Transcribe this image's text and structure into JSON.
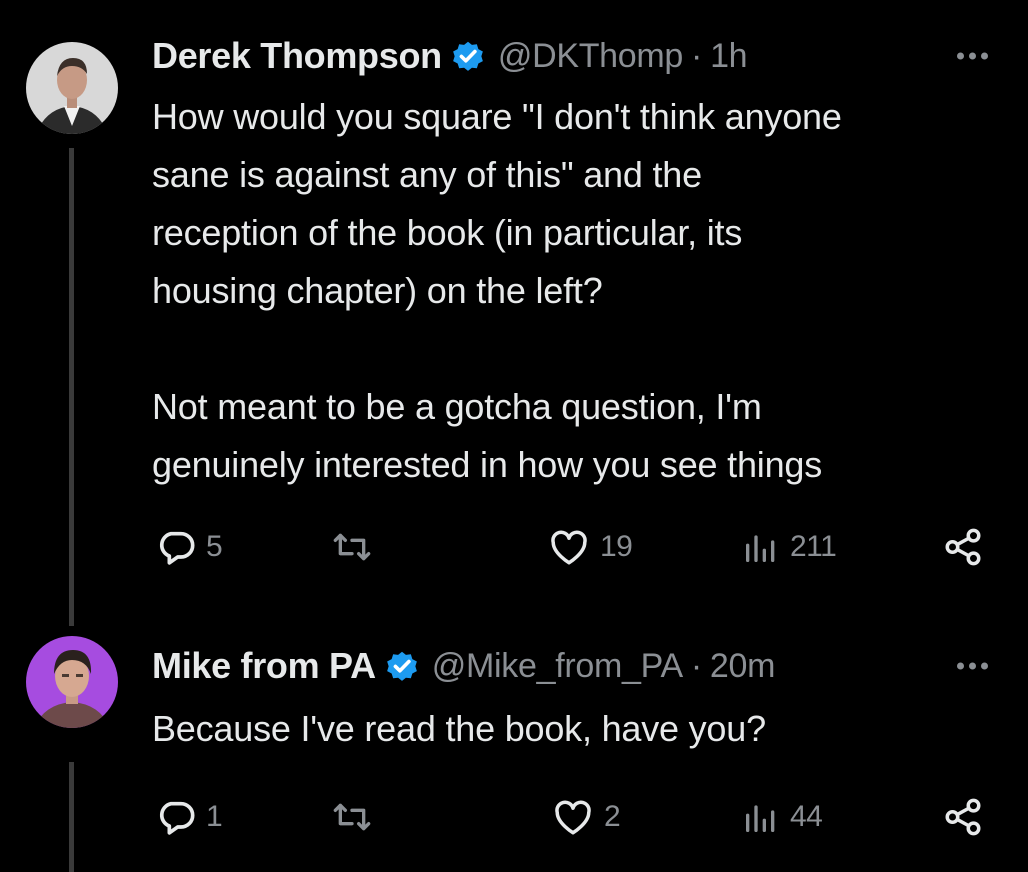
{
  "tweets": [
    {
      "author_name": "Derek Thompson",
      "verified": true,
      "handle": "@DKThomp",
      "separator": "·",
      "time": "1h",
      "text_lines": [
        "How would you square \"I don't think anyone",
        "sane is against any of this\" and the",
        "reception of the book (in particular, its",
        "housing chapter) on the left?",
        "",
        "Not meant to be a gotcha question, I'm",
        "genuinely interested in how you see things"
      ],
      "replies": "5",
      "likes": "19",
      "views": "211",
      "avatar_bg": "#dcdcdc"
    },
    {
      "author_name": "Mike from PA",
      "verified": true,
      "handle": "@Mike_from_PA",
      "separator": "·",
      "time": "20m",
      "text_lines": [
        "Because I've read the book, have you?"
      ],
      "replies": "1",
      "likes": "2",
      "views": "44",
      "avatar_bg": "#a64ce0"
    }
  ],
  "colors": {
    "background": "#000000",
    "primary_text": "#e7e9ea",
    "secondary_text": "#8b8f94",
    "verified_badge": "#1d9bf0",
    "thread_line": "#3a3a3a"
  },
  "icons": {
    "reply": "reply-icon",
    "retweet": "retweet-icon",
    "like": "heart-icon",
    "views": "views-icon",
    "share": "share-icon",
    "more": "more-icon",
    "verified": "verified-badge-icon"
  }
}
